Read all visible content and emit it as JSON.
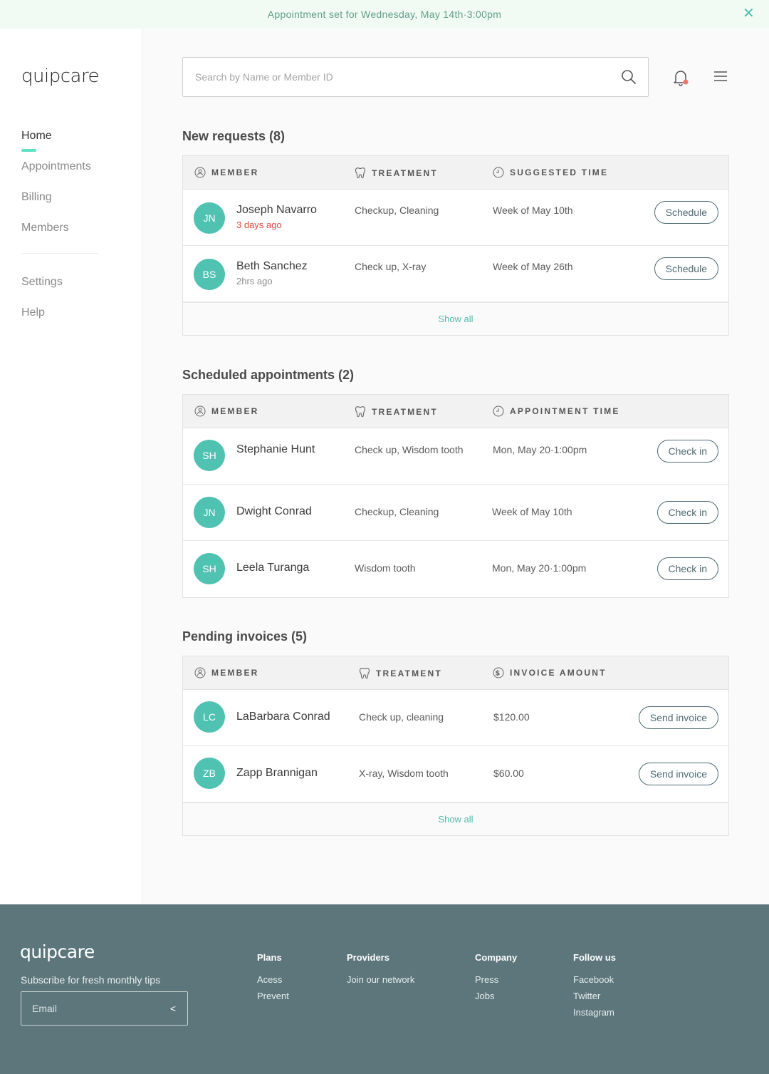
{
  "banner": {
    "message": "Appointment set for Wednesday, May 14th·3:00pm",
    "close_glyph": "✕"
  },
  "brand": {
    "logo_text": "quipcare"
  },
  "sidebar": {
    "items": [
      {
        "label": "Home",
        "active": true
      },
      {
        "label": "Appointments",
        "active": false
      },
      {
        "label": "Billing",
        "active": false
      },
      {
        "label": "Members",
        "active": false
      }
    ],
    "secondary": [
      {
        "label": "Settings"
      },
      {
        "label": "Help"
      }
    ]
  },
  "header": {
    "search_placeholder": "Search by Name or Member ID",
    "icons": [
      "search-icon",
      "bell-icon",
      "menu-icon"
    ],
    "notification_dot_color": "#f2756a"
  },
  "new_requests": {
    "title": "New requests (8)",
    "columns": [
      "MEMBER",
      "TREATMENT",
      "SUGGESTED TIME"
    ],
    "rows": [
      {
        "initials": "JN",
        "name": "Joseph Navarro",
        "sub": "3 days ago",
        "sub_alert": true,
        "treatment": "Checkup, Cleaning",
        "time": "Week of May 10th",
        "action": "Schedule"
      },
      {
        "initials": "BS",
        "name": "Beth Sanchez",
        "sub": "2hrs ago",
        "sub_alert": false,
        "treatment": "Check up, X-ray",
        "time": "Week of May 26th",
        "action": "Schedule"
      }
    ],
    "show_all": "Show all"
  },
  "scheduled": {
    "title": "Scheduled appointments (2)",
    "columns": [
      "MEMBER",
      "TREATMENT",
      "APPOINTMENT TIME"
    ],
    "rows": [
      {
        "initials": "SH",
        "name": "Stephanie Hunt",
        "treatment": "Check up, Wisdom tooth",
        "time": "Mon, May 20·1:00pm",
        "action": "Check in"
      },
      {
        "initials": "JN",
        "name": "Dwight Conrad",
        "treatment": "Checkup, Cleaning",
        "time": "Week of May 10th",
        "action": "Check in"
      },
      {
        "initials": "SH",
        "name": "Leela Turanga",
        "treatment": "Wisdom tooth",
        "time": "Mon, May 20·1:00pm",
        "action": "Check in"
      }
    ]
  },
  "invoices": {
    "title": "Pending invoices (5)",
    "columns": [
      "MEMBER",
      "TREATMENT",
      "INVOICE AMOUNT"
    ],
    "rows": [
      {
        "initials": "LC",
        "name": "LaBarbara Conrad",
        "treatment": "Check up, cleaning",
        "amount": "$120.00",
        "action": "Send invoice"
      },
      {
        "initials": "ZB",
        "name": "Zapp Brannigan",
        "treatment": "X-ray, Wisdom tooth",
        "amount": "$60.00",
        "action": "Send invoice"
      }
    ],
    "show_all": "Show all"
  },
  "footer": {
    "logo_text": "quipcare",
    "subscribe_text": "Subscribe for fresh monthly tips",
    "email_placeholder": "Email",
    "submit_glyph": "<",
    "columns": [
      {
        "title": "Plans",
        "links": [
          "Acess",
          "Prevent"
        ]
      },
      {
        "title": "Providers",
        "links": [
          "Join our network"
        ]
      },
      {
        "title": "Company",
        "links": [
          "Press",
          "Jobs"
        ]
      },
      {
        "title": "Follow us",
        "links": [
          "Facebook",
          "Twitter",
          "Instagram"
        ]
      }
    ]
  },
  "colors": {
    "accent": "#4fc2b1",
    "footer_bg": "#5c767b",
    "banner_bg": "#f2fbf3",
    "alert": "#e2483d"
  }
}
